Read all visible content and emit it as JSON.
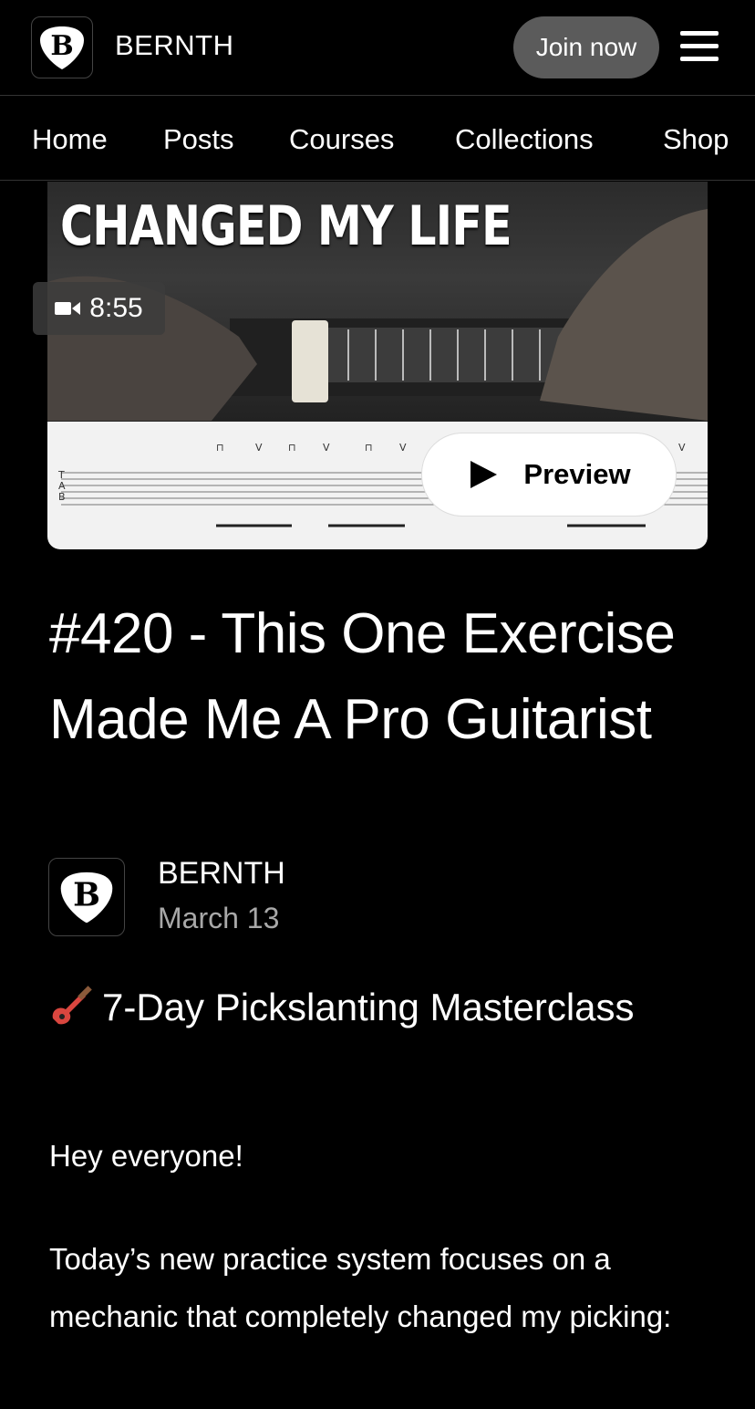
{
  "header": {
    "brand": "BERNTH",
    "join_label": "Join now"
  },
  "nav": {
    "items": [
      "Home",
      "Posts",
      "Courses",
      "Collections",
      "Shop"
    ]
  },
  "video": {
    "thumb_title": "CHANGED MY LIFE",
    "duration": "8:55",
    "preview_label": "Preview"
  },
  "post": {
    "title": "#420 - This One Exercise Made Me A Pro Guitarist",
    "author": "BERNTH",
    "date": "March 13",
    "course_heading": "7-Day Pickslanting Masterclass",
    "greeting": "Hey everyone!",
    "intro": "Today’s new practice system focuses on a mechanic that completely changed my picking:"
  }
}
